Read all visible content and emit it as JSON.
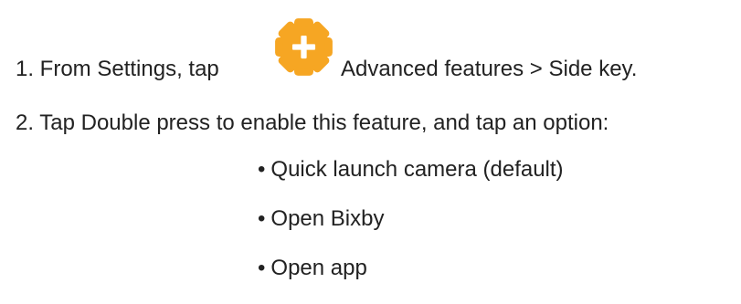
{
  "steps": [
    {
      "prefix": "1. From Settings, tap",
      "icon": "settings-gear-icon",
      "suffix": "Advanced features > Side key."
    },
    {
      "text": "2. Tap Double press to enable this feature, and tap an option:"
    }
  ],
  "options": [
    "Quick launch camera (default)",
    "Open Bixby",
    "Open app"
  ],
  "bullet": "•",
  "colors": {
    "icon_orange": "#F6A623",
    "text": "#222222"
  }
}
